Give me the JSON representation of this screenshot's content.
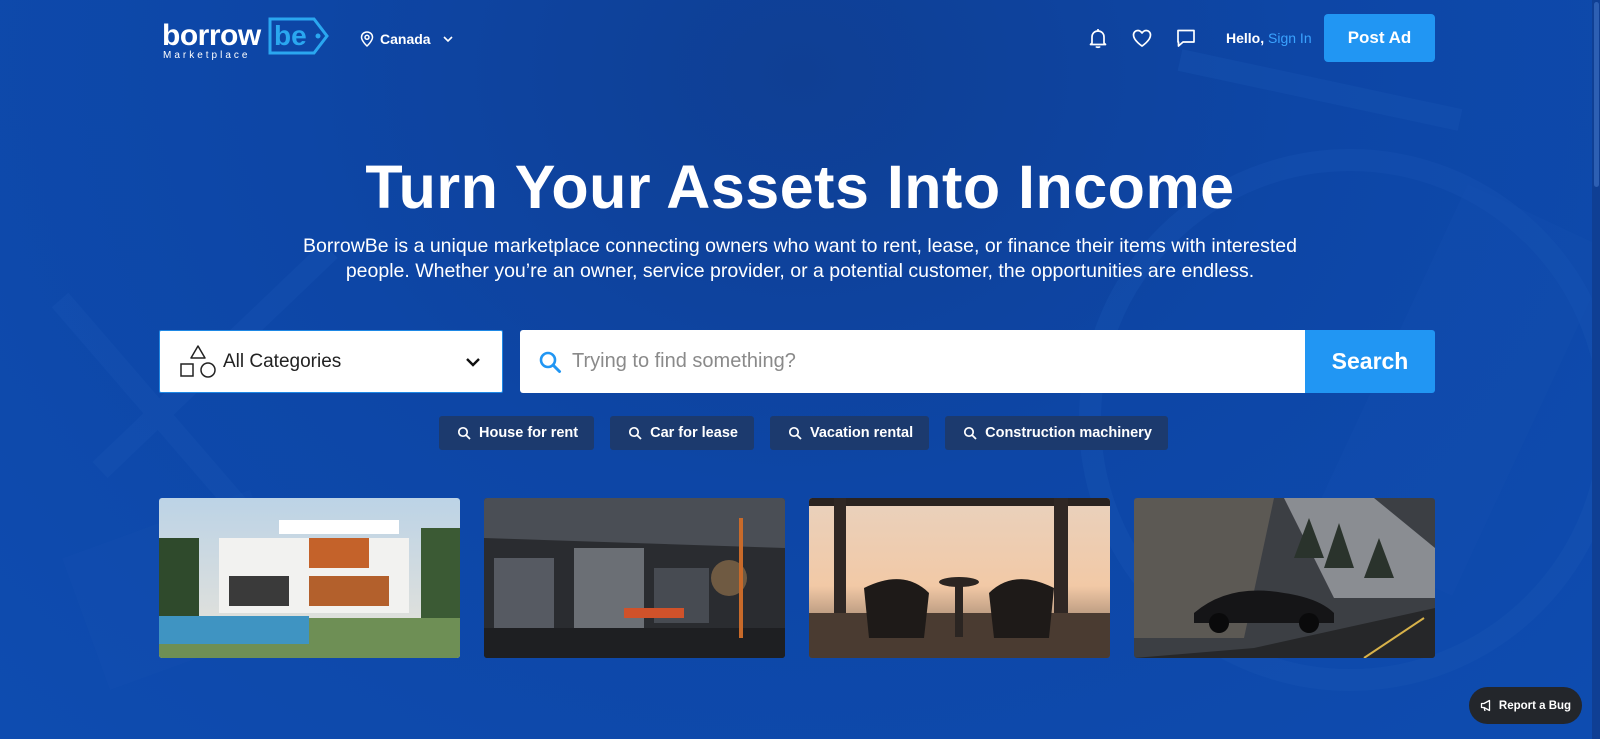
{
  "header": {
    "logo_text": "borrowBe",
    "logo_subtext": "Marketplace",
    "location": "Canada",
    "greeting": "Hello,",
    "sign_in": "Sign In",
    "post_ad": "Post Ad"
  },
  "hero": {
    "title": "Turn Your Assets Into Income",
    "subtitle_line1": "BorrowBe is a unique marketplace connecting owners who want to rent, lease, or finance their items with interested",
    "subtitle_line2": "people. Whether you’re an owner, service provider, or a potential customer, the opportunities are endless."
  },
  "search": {
    "category": "All Categories",
    "placeholder": "Trying to find something?",
    "button": "Search"
  },
  "tags": [
    "House for rent",
    "Car for lease",
    "Vacation rental",
    "Construction machinery"
  ],
  "cards": [
    {
      "icon": "modern-house-image"
    },
    {
      "icon": "industrial-workshop-image"
    },
    {
      "icon": "vacation-terrace-image"
    },
    {
      "icon": "sports-car-image"
    }
  ],
  "report_bug": "Report a Bug",
  "colors": {
    "background": "#0d46a6",
    "accent": "#2196f3",
    "link": "#3aa3ff",
    "tag_bg": "#1c3a6e",
    "report_bg": "#23262b"
  }
}
